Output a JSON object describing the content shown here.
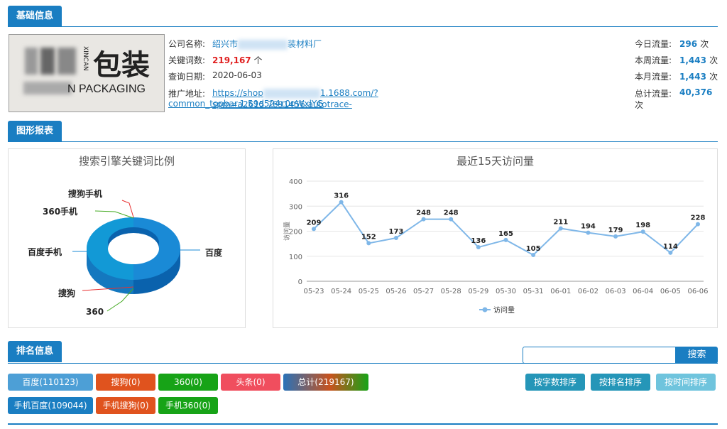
{
  "sections": {
    "basic": "基础信息",
    "charts": "图形报表",
    "ranking": "排名信息"
  },
  "logo": {
    "text_cn": "包装",
    "text_en": "N PACKAGING",
    "vertical": "XINCAN"
  },
  "info": {
    "company_label": "公司名称:",
    "company_value_a": "绍兴市",
    "company_value_b": "装材料厂",
    "keywords_label": "关键词数:",
    "keywords_value": "219,167",
    "keywords_unit": "个",
    "date_label": "查询日期:",
    "date_value": "2020-06-03",
    "url_label": "推广地址:",
    "url_line1": "https://shop",
    "url_line1b": "1.1688.com/?spm=a2615.7691456.autotrace-",
    "url_line2": "common_topbar.1.59d524c0nWxlYG"
  },
  "stats": {
    "today_label": "今日流量:",
    "today_value": "296",
    "week_label": "本周流量:",
    "week_value": "1,443",
    "month_label": "本月流量:",
    "month_value": "1,443",
    "total_label": "总计流量:",
    "total_value": "40,376",
    "unit": "次"
  },
  "pie": {
    "title": "搜索引擎关键词比例",
    "labels": [
      "搜狗手机",
      "360手机",
      "百度手机",
      "搜狗",
      "360",
      "百度"
    ]
  },
  "chart_data": {
    "type": "line",
    "title": "最近15天访问量",
    "ylabel": "访问量",
    "ylim": [
      0,
      400
    ],
    "yticks": [
      0,
      100,
      200,
      300,
      400
    ],
    "categories": [
      "05-23",
      "05-24",
      "05-25",
      "05-26",
      "05-27",
      "05-28",
      "05-29",
      "05-30",
      "05-31",
      "06-01",
      "06-02",
      "06-03",
      "06-04",
      "06-05",
      "06-06"
    ],
    "series": [
      {
        "name": "访问量",
        "values": [
          209,
          316,
          152,
          173,
          248,
          248,
          136,
          165,
          105,
          211,
          194,
          179,
          198,
          114,
          228
        ]
      }
    ],
    "color": "#7fb7e8"
  },
  "search": {
    "button": "搜索",
    "placeholder": ""
  },
  "filters": [
    {
      "label": "百度(110123)",
      "color": "#4d9fd6"
    },
    {
      "label": "搜狗(0)",
      "color": "#e0531e"
    },
    {
      "label": "360(0)",
      "color": "#17a317"
    },
    {
      "label": "头条(0)",
      "color": "#f04e5e"
    },
    {
      "label": "总计(219167)",
      "color": "#2a72b8"
    },
    {
      "label": "手机百度(109044)",
      "color": "#1a7ec2"
    },
    {
      "label": "手机搜狗(0)",
      "color": "#e0531e"
    },
    {
      "label": "手机360(0)",
      "color": "#17a317"
    }
  ],
  "sort": {
    "by_words": "按字数排序",
    "by_rank": "按排名排序",
    "by_time": "按时间排序"
  }
}
